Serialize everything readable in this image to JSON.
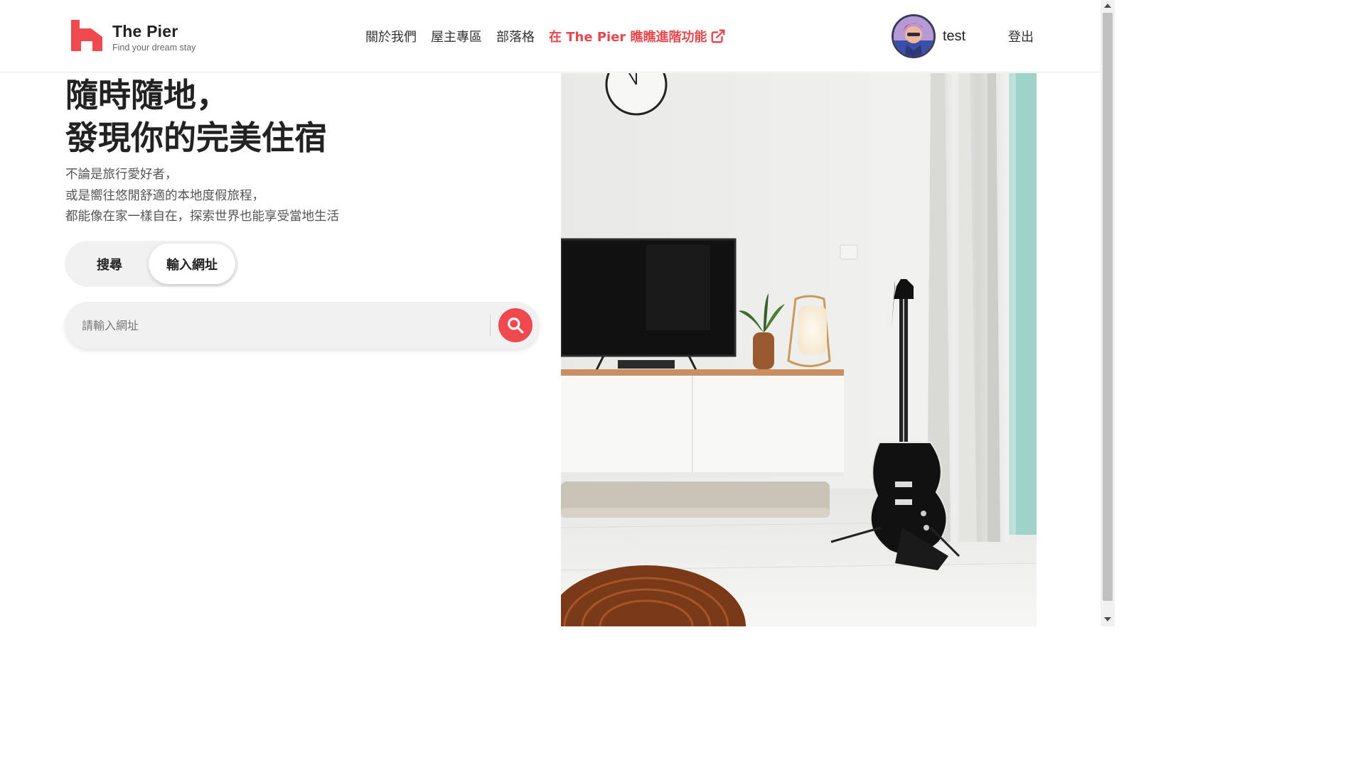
{
  "header": {
    "brand_title": "The Pier",
    "brand_subtitle": "Find your dream stay",
    "nav": {
      "about": "關於我們",
      "hosts": "屋主專區",
      "blog": "部落格",
      "advanced": "在 The Pier 瞧瞧進階功能"
    },
    "username": "test",
    "logout": "登出"
  },
  "hero": {
    "title_line1": "隨時隨地，",
    "title_line2": "發現你的完美住宿",
    "desc_line1": "不論是旅行愛好者，",
    "desc_line2": "或是嚮往悠閒舒適的本地度假旅程，",
    "desc_line3": "都能像在家一樣自在，探索世界也能享受當地生活"
  },
  "toggle": {
    "search_label": "搜尋",
    "url_label": "輸入網址",
    "selected": "輸入網址"
  },
  "searchbar": {
    "placeholder": "請輸入網址",
    "value": ""
  },
  "icons": {
    "logo": "house-logo-icon",
    "external": "external-link-icon",
    "search": "search-icon"
  },
  "colors": {
    "accent": "#f0484f",
    "brand": "#e5484d",
    "text": "#222222"
  }
}
